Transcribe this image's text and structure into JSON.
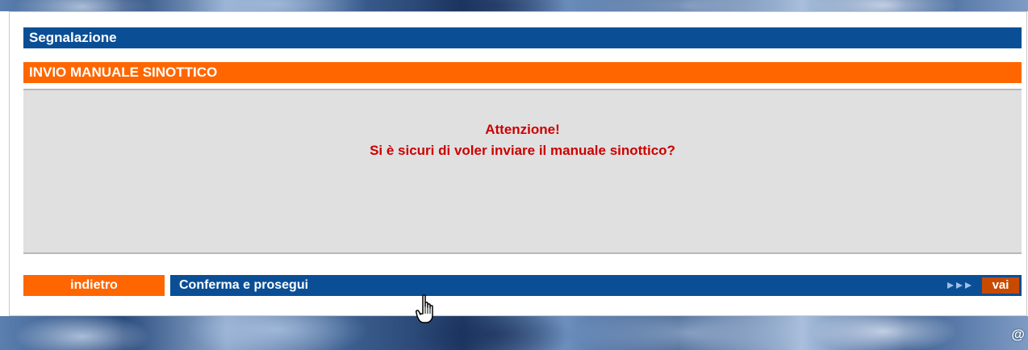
{
  "section": {
    "title": "Segnalazione"
  },
  "subsection": {
    "title": "INVIO MANUALE SINOTTICO"
  },
  "message": {
    "title": "Attenzione!",
    "question": "Si è sicuri di voler inviare il manuale sinottico?"
  },
  "actions": {
    "back_label": "indietro",
    "confirm_label": "Conferma e prosegui",
    "go_label": "vai"
  },
  "footer": {
    "at_symbol": "@"
  },
  "colors": {
    "header_blue": "#0a4f96",
    "accent_orange": "#ff6600",
    "alert_red": "#cc0000",
    "message_bg": "#e0e0e0"
  },
  "icons": {
    "arrows": "triple-right-arrow-icon",
    "cursor": "hand-pointer-cursor-icon"
  }
}
